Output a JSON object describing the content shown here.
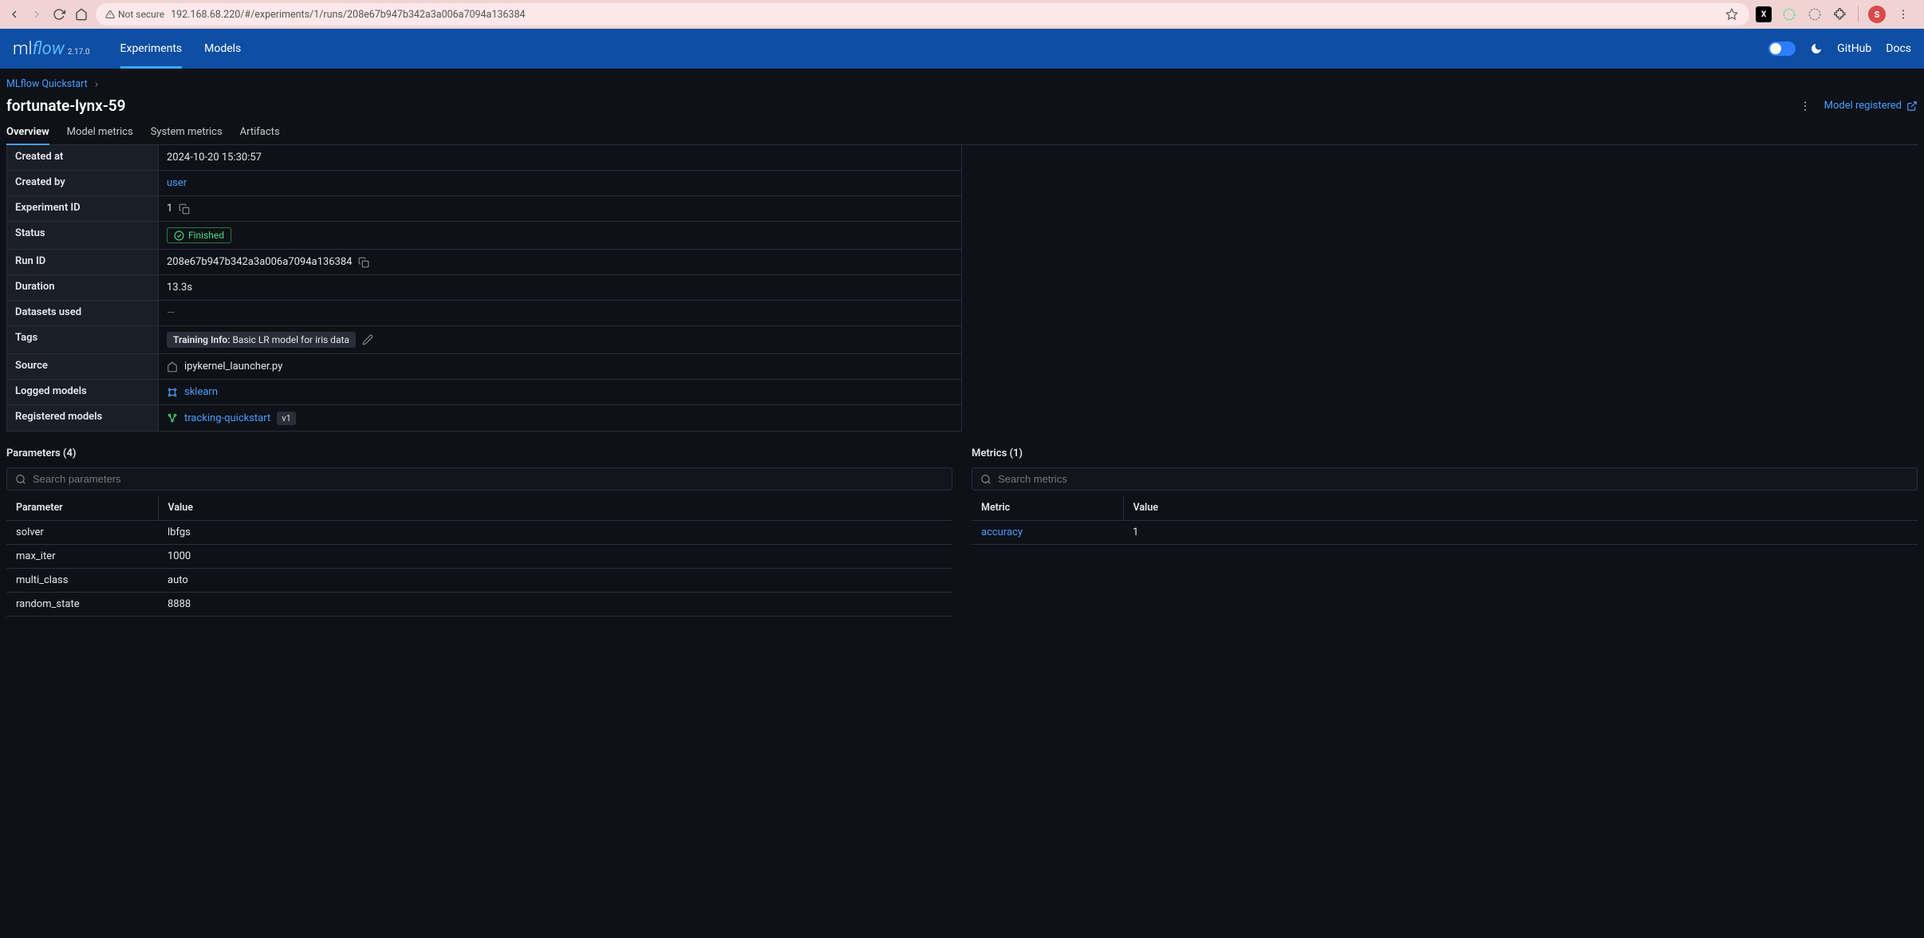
{
  "browser": {
    "url": "192.168.68.220/#/experiments/1/runs/208e67b947b342a3a006a7094a136384",
    "not_secure": "Not secure",
    "avatar_initial": "S"
  },
  "nav": {
    "logo_ml": "ml",
    "logo_flow": "flow",
    "version": "2.17.0",
    "items": [
      "Experiments",
      "Models"
    ],
    "github": "GitHub",
    "docs": "Docs"
  },
  "breadcrumb": {
    "parent": "MLflow Quickstart"
  },
  "run": {
    "title": "fortunate-lynx-59",
    "registered_label": "Model registered",
    "tabs": [
      "Overview",
      "Model metrics",
      "System metrics",
      "Artifacts"
    ]
  },
  "details": {
    "rows": {
      "created_at": {
        "label": "Created at",
        "value": "2024-10-20 15:30:57"
      },
      "created_by": {
        "label": "Created by",
        "value": "user"
      },
      "experiment_id": {
        "label": "Experiment ID",
        "value": "1"
      },
      "status": {
        "label": "Status",
        "value": "Finished"
      },
      "run_id": {
        "label": "Run ID",
        "value": "208e67b947b342a3a006a7094a136384"
      },
      "duration": {
        "label": "Duration",
        "value": "13.3s"
      },
      "datasets": {
        "label": "Datasets used",
        "value": "—"
      },
      "tags": {
        "label": "Tags",
        "tag_key": "Training Info:",
        "tag_val": " Basic LR model for iris data"
      },
      "source": {
        "label": "Source",
        "value": "ipykernel_launcher.py"
      },
      "logged_models": {
        "label": "Logged models",
        "value": "sklearn"
      },
      "registered_models": {
        "label": "Registered models",
        "value": "tracking-quickstart",
        "version": "v1"
      }
    }
  },
  "parameters": {
    "title": "Parameters (4)",
    "search_placeholder": "Search parameters",
    "cols": [
      "Parameter",
      "Value"
    ],
    "rows": [
      {
        "k": "solver",
        "v": "lbfgs"
      },
      {
        "k": "max_iter",
        "v": "1000"
      },
      {
        "k": "multi_class",
        "v": "auto"
      },
      {
        "k": "random_state",
        "v": "8888"
      }
    ]
  },
  "metrics": {
    "title": "Metrics (1)",
    "search_placeholder": "Search metrics",
    "cols": [
      "Metric",
      "Value"
    ],
    "rows": [
      {
        "k": "accuracy",
        "v": "1"
      }
    ]
  }
}
